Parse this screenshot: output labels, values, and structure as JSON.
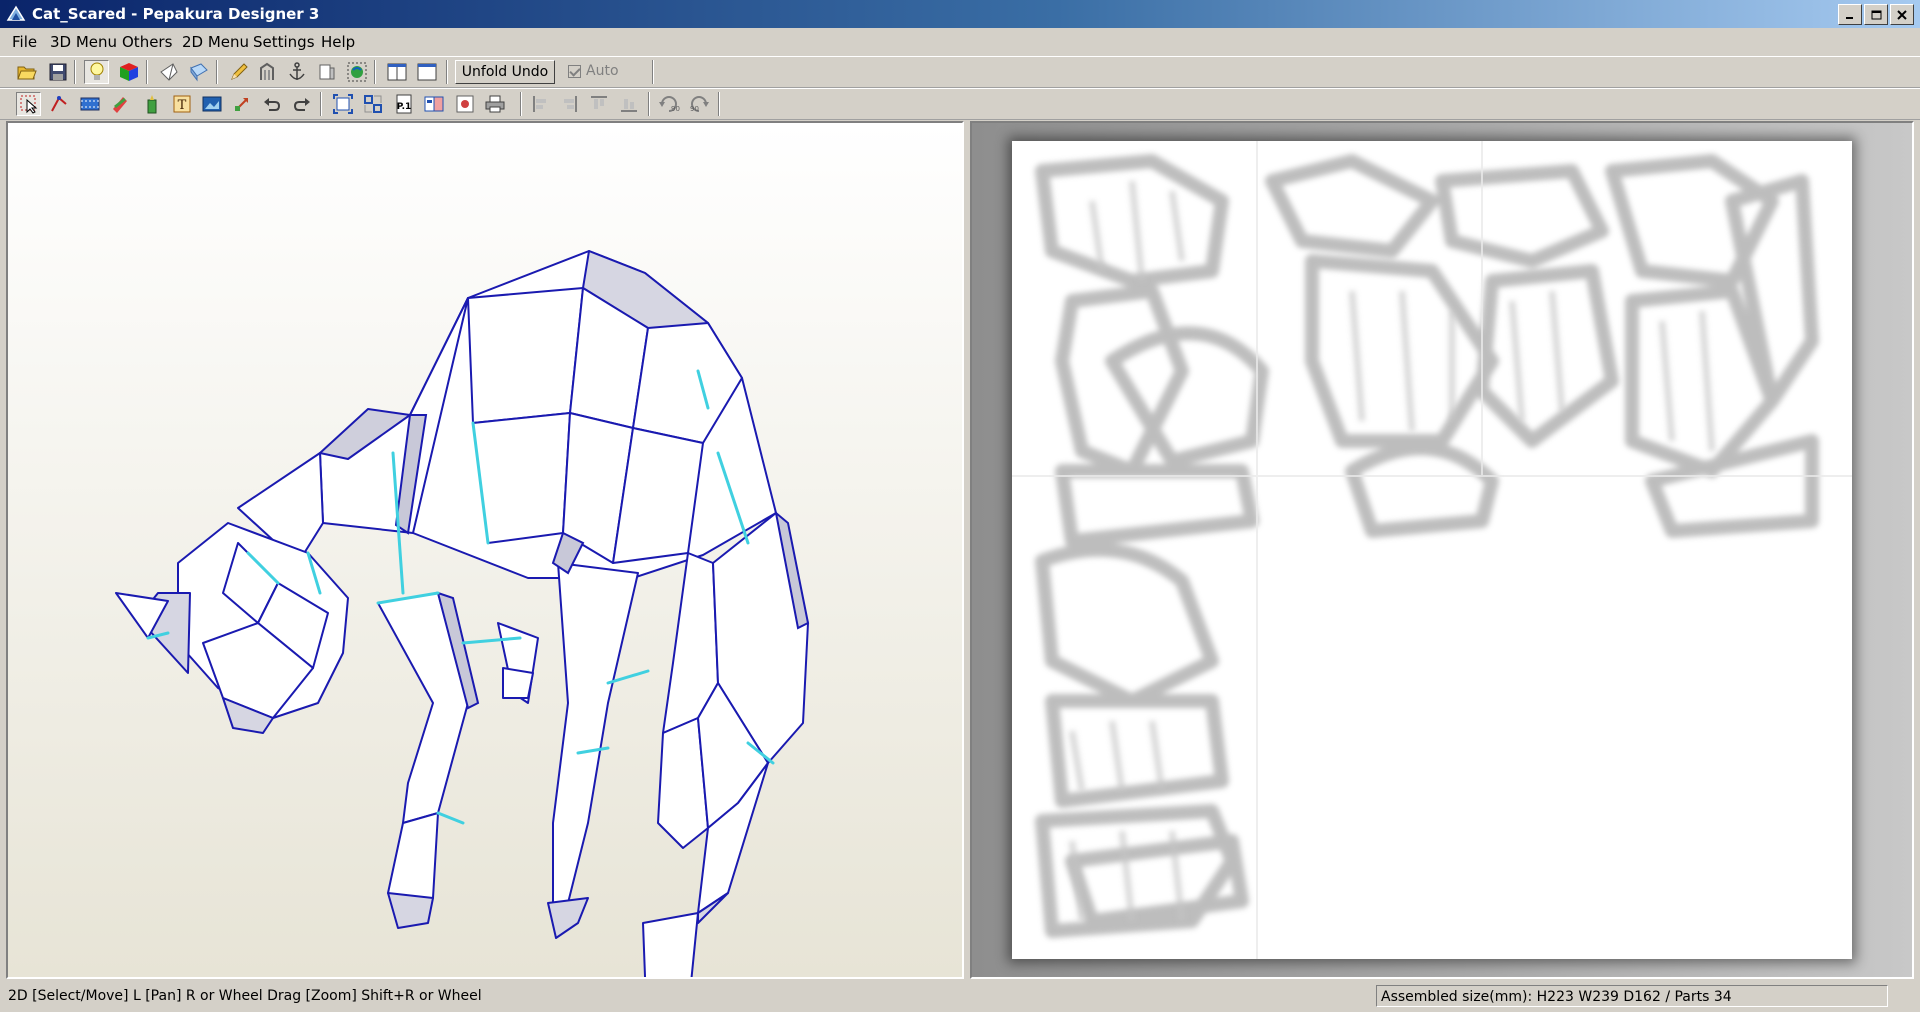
{
  "window": {
    "title": "Cat_Scared - Pepakura Designer 3"
  },
  "menu": [
    "File",
    "3D Menu",
    "Others",
    "2D Menu",
    "Settings",
    "Help"
  ],
  "toolbar": {
    "unfold_undo": "Unfold Undo",
    "auto_label": "Auto",
    "auto_checked": true
  },
  "status": {
    "left": "2D [Select/Move] L [Pan] R or Wheel Drag [Zoom] Shift+R or Wheel",
    "right": "Assembled size(mm): H223 W239 D162 / Parts 34"
  },
  "colors": {
    "mesh_edge": "#1a1ab0",
    "mountain_fold": "#40d0e0",
    "face": "#ffffff",
    "shade": "#d2d2dc"
  }
}
